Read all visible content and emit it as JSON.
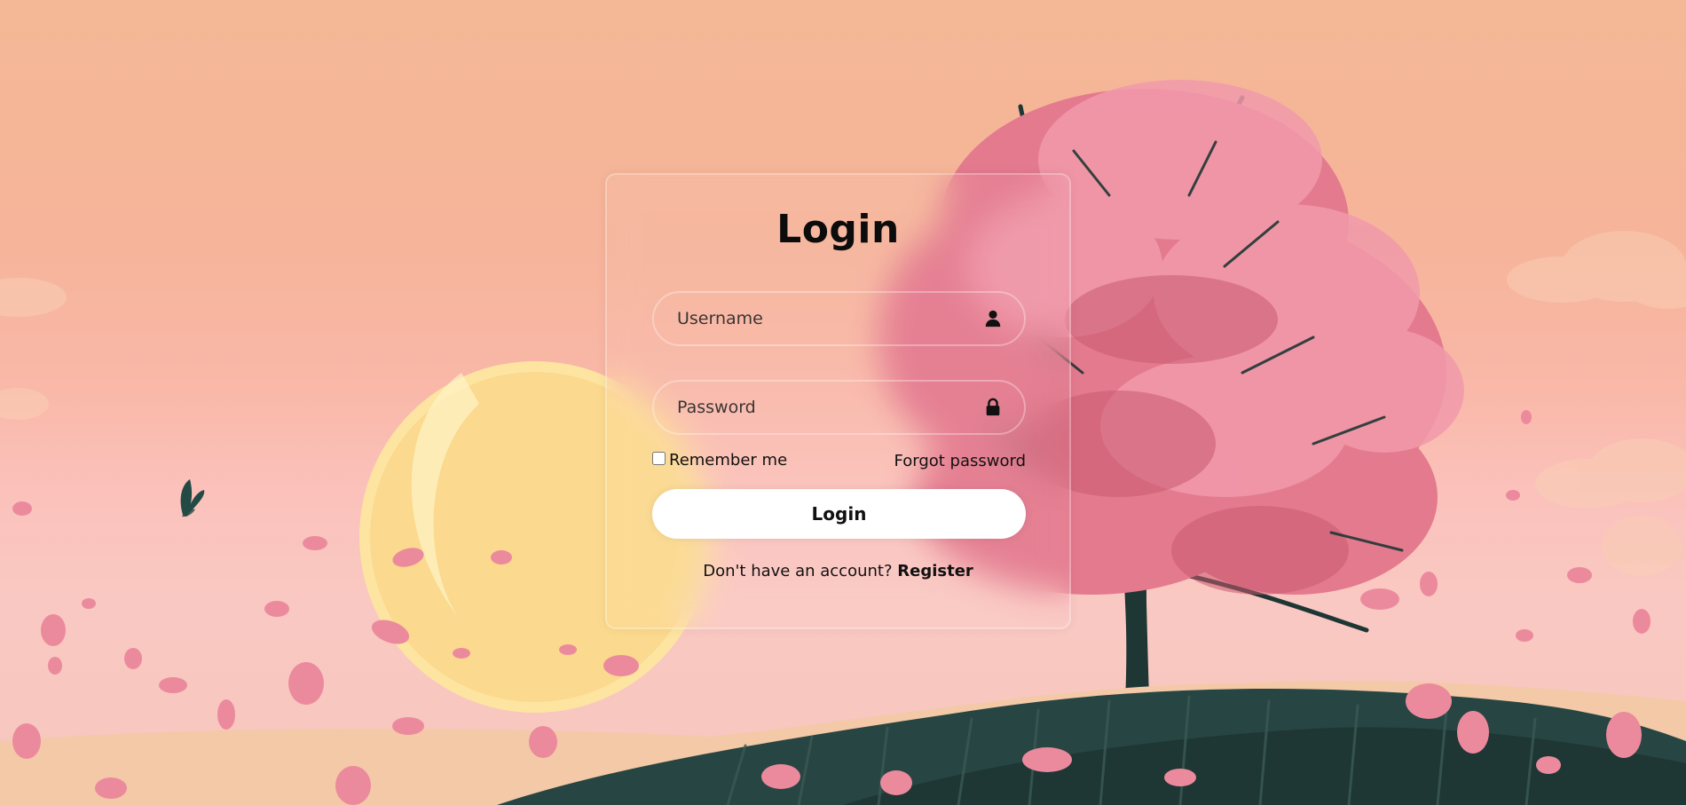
{
  "login": {
    "title": "Login",
    "username_placeholder": "Username",
    "password_placeholder": "Password",
    "remember_label": "Remember me",
    "forgot_label": "Forgot password",
    "submit_label": "Login",
    "register_prompt": "Don't have an account?",
    "register_label": "Register"
  },
  "icons": {
    "username": "user-icon",
    "password": "lock-icon"
  },
  "colors": {
    "sky": "#f4b896",
    "blossom": "#e8778c",
    "moon": "#fbe08f",
    "grass": "#1f3a38",
    "button": "#ffffff"
  }
}
